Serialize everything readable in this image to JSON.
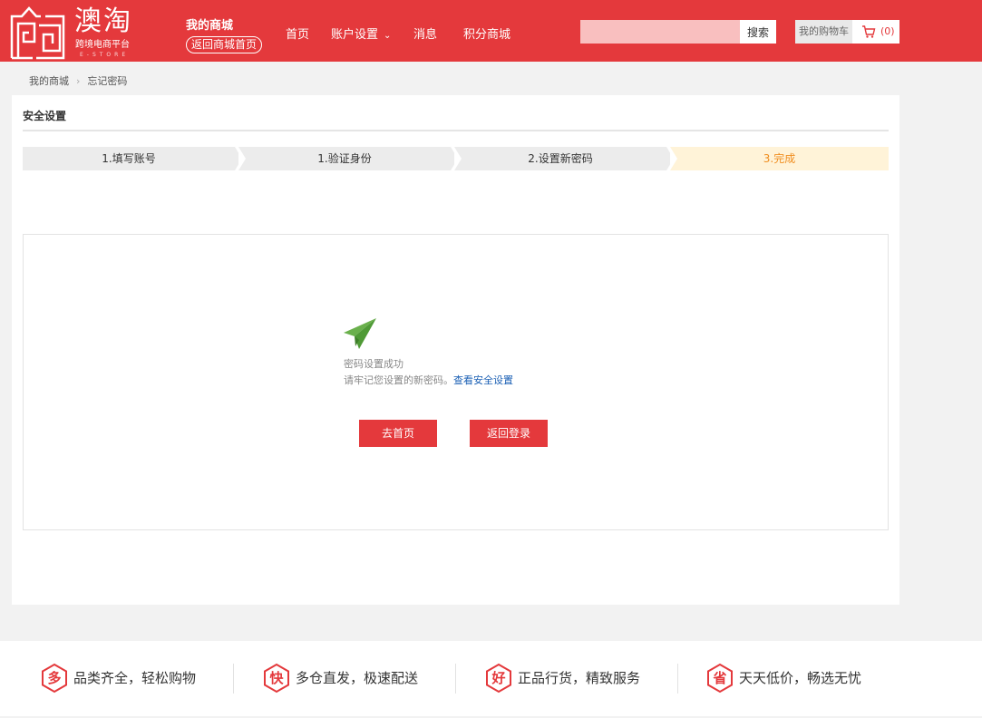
{
  "header": {
    "logo": {
      "brand": "澳淘",
      "tagline": "跨境电商平台",
      "tagline_sub": "E-STORE"
    },
    "my_mall": "我的商城",
    "back_home": "返回商城首页",
    "nav": {
      "home": "首页",
      "account": "账户设置",
      "messages": "消息",
      "points": "积分商城"
    },
    "search": {
      "placeholder": "",
      "button": "搜索"
    },
    "cart": {
      "label": "我的购物车",
      "count": "(0)"
    }
  },
  "breadcrumb": {
    "root": "我的商城",
    "current": "忘记密码"
  },
  "panel": {
    "title": "安全设置",
    "steps": [
      "1.填写账号",
      "1.验证身份",
      "2.设置新密码",
      "3.完成"
    ],
    "active_step": 4,
    "result": {
      "line1": "密码设置成功",
      "line2": "请牢记您设置的新密码。",
      "link": "查看安全设置",
      "btn_home": "去首页",
      "btn_login": "返回登录"
    }
  },
  "footer": {
    "features": [
      {
        "icon_char": "多",
        "text": "品类齐全，轻松购物"
      },
      {
        "icon_char": "快",
        "text": "多仓直发，极速配送"
      },
      {
        "icon_char": "好",
        "text": "正品行货，精致服务"
      },
      {
        "icon_char": "省",
        "text": "天天低价，畅选无忧"
      }
    ]
  },
  "colors": {
    "brand_red": "#e4393c",
    "active_step_bg": "#fff3d8",
    "active_step_text": "#f08d1e",
    "success_green": "#6ab04c",
    "link_blue": "#1a5fb4"
  }
}
